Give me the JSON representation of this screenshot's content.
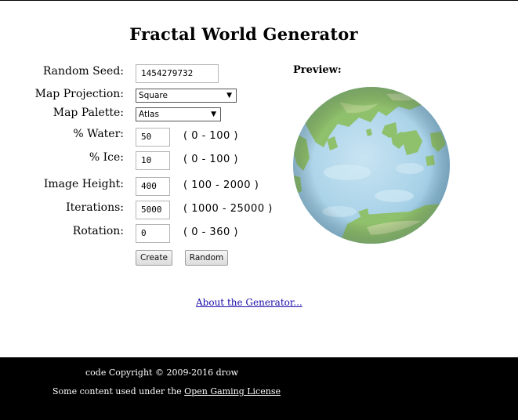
{
  "page": {
    "title": "Fractal World Generator"
  },
  "form": {
    "seed": {
      "label": "Random Seed:",
      "value": "1454279732"
    },
    "projection": {
      "label": "Map Projection:",
      "value": "Square"
    },
    "palette": {
      "label": "Map Palette:",
      "value": "Atlas"
    },
    "water": {
      "label": "% Water:",
      "value": "50",
      "range": "( 0 - 100 )"
    },
    "ice": {
      "label": "% Ice:",
      "value": "10",
      "range": "( 0 - 100 )"
    },
    "height": {
      "label": "Image Height:",
      "value": "400",
      "range": "( 100 - 2000 )"
    },
    "iterations": {
      "label": "Iterations:",
      "value": "5000",
      "range": "( 1000 - 25000 )"
    },
    "rotation": {
      "label": "Rotation:",
      "value": "0",
      "range": "( 0 - 360 )"
    },
    "create_label": "Create",
    "random_label": "Random"
  },
  "preview": {
    "label": "Preview:"
  },
  "links": {
    "about": "About the Generator..."
  },
  "footer": {
    "copyright": "code Copyright © 2009-2016 drow",
    "content_prefix": "Some content used under the ",
    "ogl_link": "Open Gaming License"
  },
  "colors": {
    "ocean": "#a8d3ea",
    "land": "#8fc06c",
    "footer_bg": "#000000",
    "link": "#1a0dab"
  }
}
